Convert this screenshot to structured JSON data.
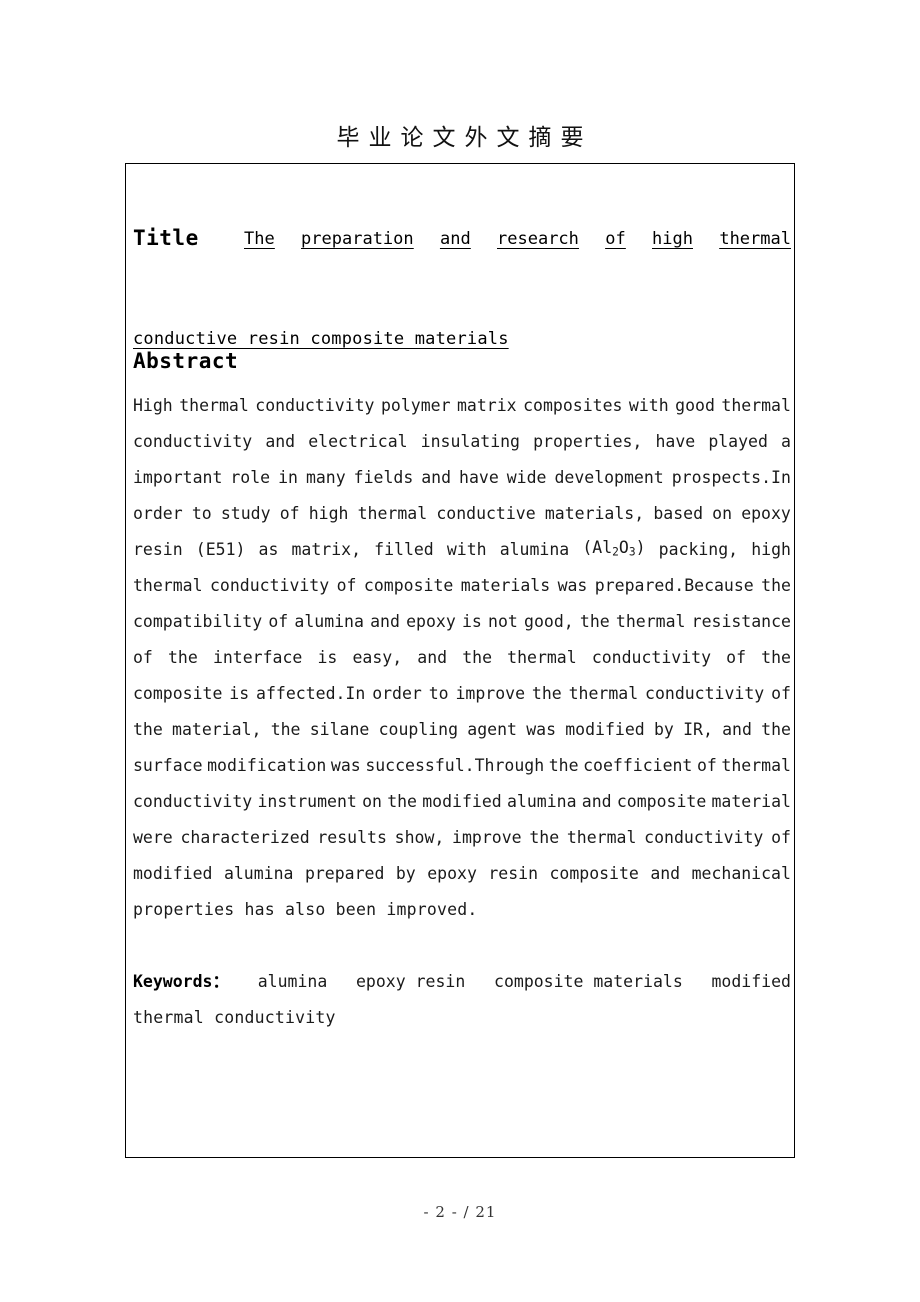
{
  "page": {
    "header_title": "毕业论文外文摘要",
    "footer_text": "- 2 - / 21"
  },
  "title_section": {
    "label": "Title",
    "line1_words": [
      "The",
      "preparation",
      "and",
      "research",
      "of",
      "high",
      "thermal"
    ],
    "line2": "conductive resin composite materials",
    "full_text": "The preparation and research of high thermal conductive resin composite materials"
  },
  "abstract_section": {
    "heading": "Abstract",
    "lines": [
      [
        "High",
        "thermal",
        "conductivity",
        "polymer",
        "matrix",
        "composites",
        "with",
        "good",
        "thermal"
      ],
      [
        "conductivity",
        "and",
        "electrical",
        "insulating",
        "properties,",
        "have",
        "played",
        "a"
      ],
      [
        "important",
        "role",
        "in",
        "many",
        "fields",
        "and",
        "have",
        "wide",
        "development",
        "prospects.In"
      ],
      [
        "order",
        "to",
        "study",
        "of",
        "high",
        "thermal",
        "conductive",
        "materials,",
        "based",
        "on",
        "epoxy"
      ],
      [
        "resin",
        "(E51)",
        "as",
        "matrix,",
        "filled",
        "with",
        "alumina",
        "(Al2O3)",
        "packing,",
        "high"
      ],
      [
        "thermal",
        "conductivity",
        "of",
        "composite",
        "materials",
        "was",
        "prepared.Because",
        "the"
      ],
      [
        "compatibility",
        "of",
        "alumina",
        "and",
        "epoxy",
        "is",
        "not",
        "good,",
        "the",
        "thermal",
        "resistance"
      ],
      [
        "of",
        "the",
        "interface",
        "is",
        "easy,",
        "and",
        "the",
        "thermal",
        "conductivity",
        "of",
        "the"
      ],
      [
        "composite",
        "is",
        "affected.In",
        "order",
        "to",
        "improve",
        "the",
        "thermal",
        "conductivity",
        "of"
      ],
      [
        "the",
        "material,",
        "the",
        "silane",
        "coupling",
        "agent",
        "was",
        "modified",
        "by",
        "IR,",
        "and",
        "the"
      ],
      [
        "surface",
        "modification",
        "was",
        "successful.Through",
        "the",
        "coefficient",
        "of",
        "thermal"
      ],
      [
        "conductivity",
        "instrument",
        "on",
        "the",
        "modified",
        "alumina",
        "and",
        "composite",
        "material"
      ],
      [
        "were",
        "characterized",
        "results",
        "show,",
        "improve",
        "the",
        "thermal",
        "conductivity",
        "of"
      ],
      [
        "modified",
        "alumina",
        "prepared",
        "by",
        "epoxy",
        "resin",
        "composite",
        "and",
        "mechanical"
      ]
    ],
    "last_line": "properties has also been improved.",
    "full_text": "High thermal conductivity polymer matrix composites with good thermal conductivity and electrical insulating properties, have played a important role in many fields and have wide development prospects.In order to study of high thermal conductive materials, based on epoxy resin (E51) as matrix, filled with alumina (Al2O3) packing, high thermal conductivity of composite materials was prepared.Because the compatibility of alumina and epoxy is not good, the thermal resistance of the interface is easy, and the thermal conductivity of the composite is affected.In order to improve the thermal conductivity of the material, the silane coupling agent was modified by IR, and the surface modification was successful.Through the coefficient of thermal conductivity instrument on the modified alumina and composite material were characterized results show, improve the thermal conductivity of modified alumina prepared by epoxy resin composite and mechanical properties has also been improved."
  },
  "keywords_section": {
    "label": "Keywords：",
    "line1_items": [
      "alumina",
      "epoxy resin",
      "composite materials",
      "modified"
    ],
    "line2": "thermal conductivity",
    "all": [
      "alumina",
      "epoxy resin",
      "composite materials",
      "modified",
      "thermal conductivity"
    ]
  },
  "colors": {
    "text": "#000000",
    "body_text": "#1a1a1a",
    "border": "#000000",
    "background": "#ffffff"
  }
}
